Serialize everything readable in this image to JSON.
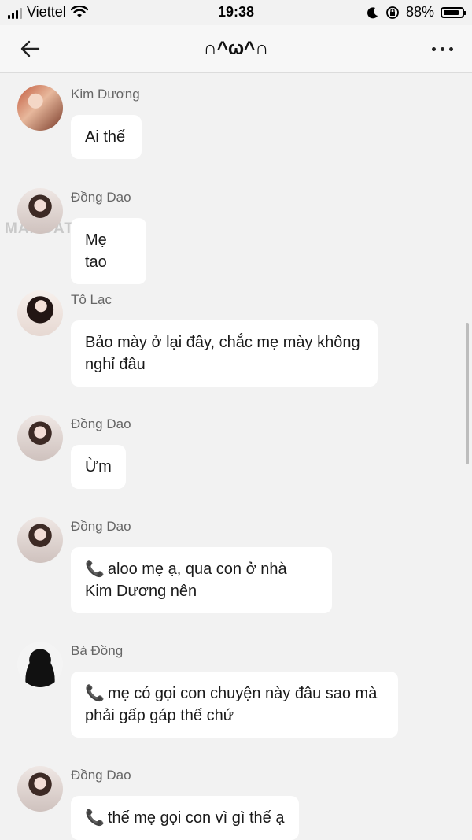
{
  "status": {
    "carrier": "Viettel",
    "time": "19:38",
    "battery": "88%",
    "battery_level": 0.88
  },
  "header": {
    "title": "∩^ω^∩"
  },
  "watermark": "MANGATOON",
  "messages": [
    {
      "sender": "Kim Dương",
      "text": "Ai thế",
      "has_phone_icon": false
    },
    {
      "sender": "Đồng Dao",
      "text": "Mẹ tao",
      "has_phone_icon": false
    },
    {
      "sender": "Tô Lạc",
      "text": "Bảo mày ở lại đây, chắc mẹ mày không nghỉ đâu",
      "has_phone_icon": false
    },
    {
      "sender": "Đồng Dao",
      "text": "Ừm",
      "has_phone_icon": false
    },
    {
      "sender": "Đồng Dao",
      "text": "aloo mẹ ạ, qua con ở nhà Kim Dương nên",
      "has_phone_icon": true
    },
    {
      "sender": "Bà Đồng",
      "text": "mẹ có gọi con chuyện này đâu sao mà phải gấp gáp thế chứ",
      "has_phone_icon": true
    },
    {
      "sender": "Đồng Dao",
      "text": "thế mẹ gọi con vì gì thế ạ",
      "has_phone_icon": true
    }
  ]
}
